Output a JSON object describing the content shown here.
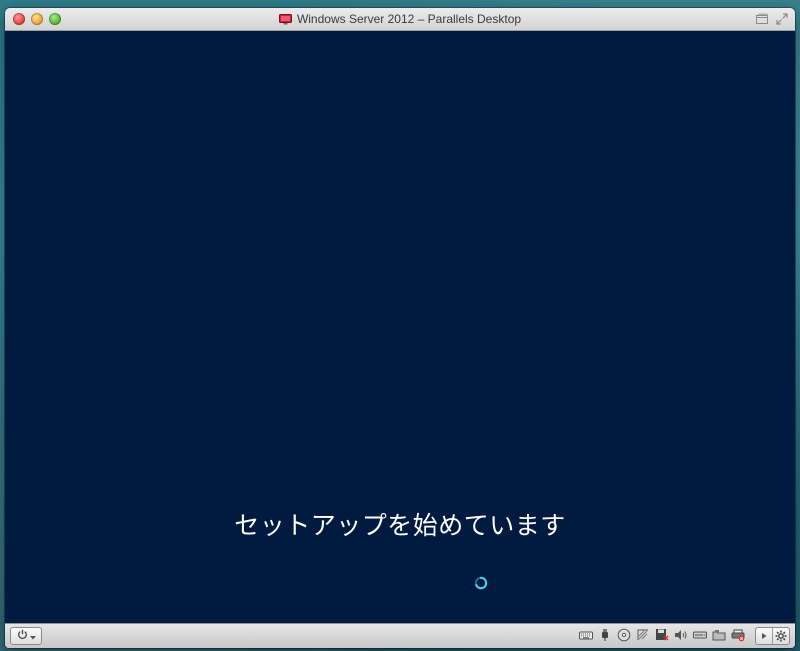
{
  "window": {
    "title": "Windows Server 2012 – Parallels Desktop"
  },
  "vm_screen": {
    "status_text": "セットアップを始めています",
    "background_color": "#001a40",
    "spinner_color": "#4fd7e8"
  },
  "toolbar": {
    "power_icon": "power-icon",
    "devices": [
      "keyboard-icon",
      "usb-icon",
      "cd-dvd-icon",
      "network-icon",
      "floppy-disk-icon",
      "sound-icon",
      "hard-disk-icon",
      "shared-folder-icon",
      "printer-icon"
    ],
    "right_icons": [
      "play-arrow-icon",
      "settings-gear-icon"
    ]
  }
}
